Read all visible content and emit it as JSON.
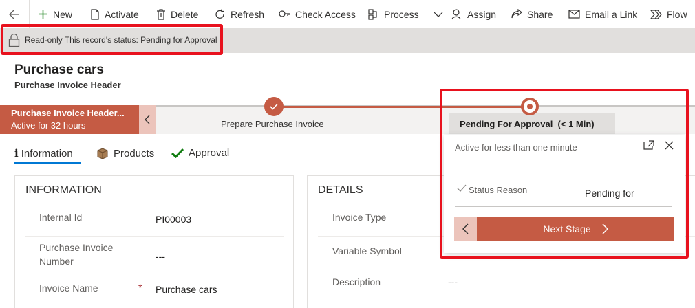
{
  "commands": [
    {
      "label": "New",
      "icon": "plus-icon"
    },
    {
      "label": "Activate",
      "icon": "document-icon"
    },
    {
      "label": "Delete",
      "icon": "trash-icon"
    },
    {
      "label": "Refresh",
      "icon": "refresh-icon"
    },
    {
      "label": "Check Access",
      "icon": "key-icon"
    },
    {
      "label": "Process",
      "icon": "process-icon"
    },
    {
      "label": "Assign",
      "icon": "person-icon"
    },
    {
      "label": "Share",
      "icon": "share-icon"
    },
    {
      "label": "Email a Link",
      "icon": "mail-icon"
    },
    {
      "label": "Flow",
      "icon": "flow-icon"
    }
  ],
  "banner": {
    "text": "Read-only This record's status: Pending for Approval"
  },
  "record": {
    "title": "Purchase cars",
    "entity": "Purchase Invoice Header"
  },
  "bpf": {
    "active_title": "Purchase Invoice Header...",
    "active_duration": "Active for 32 hours",
    "stage1": "Prepare Purchase Invoice",
    "stage2": "Pending For Approval",
    "stage2_time": "(< 1 Min)"
  },
  "tabs": [
    {
      "label": "Information",
      "icon": "info-icon",
      "selected": true
    },
    {
      "label": "Products",
      "icon": "box-icon",
      "selected": false
    },
    {
      "label": "Approval",
      "icon": "check-icon",
      "selected": false
    }
  ],
  "info_section": {
    "title": "INFORMATION",
    "fields": [
      {
        "label": "Internal Id",
        "value": "PI00003"
      },
      {
        "label_line1": "Purchase Invoice",
        "label_line2": "Number",
        "value": "---"
      },
      {
        "label": "Invoice Name",
        "required_mark": "*",
        "value": "Purchase cars"
      }
    ]
  },
  "details_section": {
    "title": "DETAILS",
    "fields": [
      {
        "label": "Invoice Type",
        "value": ""
      },
      {
        "label": "Variable Symbol",
        "value": ""
      },
      {
        "label": "Description",
        "value": "---"
      }
    ]
  },
  "flyout": {
    "status": "Active for less than one minute",
    "field_label": "Status Reason",
    "field_value": "Pending for",
    "next_label": "Next Stage"
  },
  "colors": {
    "accent": "#c55b44",
    "accent_light": "#ecc4bb",
    "highlight": "#e8121e",
    "tab_underline": "#0078d4"
  }
}
